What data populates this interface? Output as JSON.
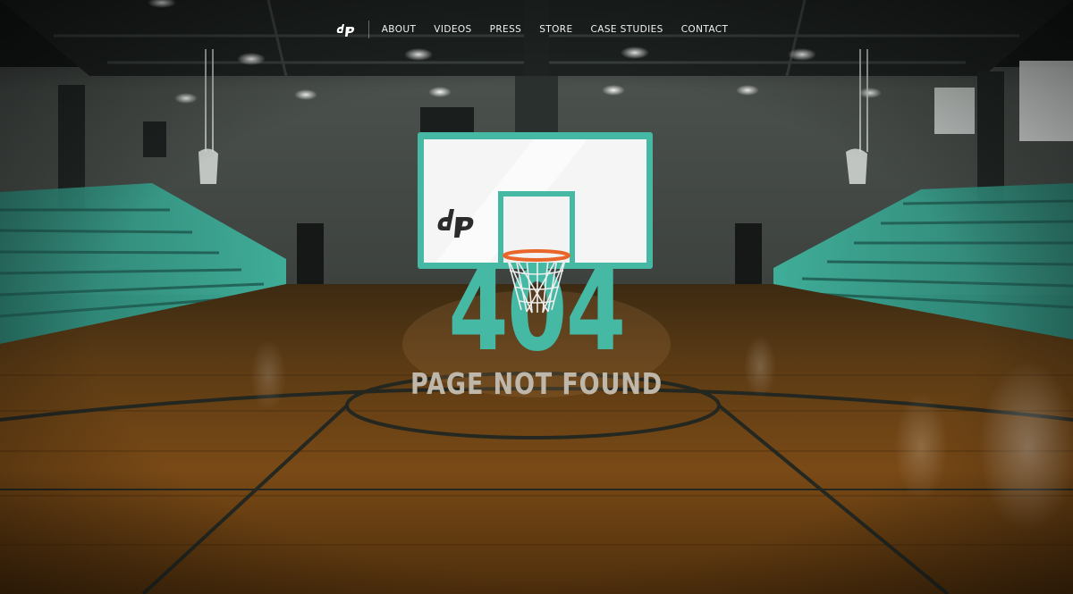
{
  "nav": {
    "logo_icon": "dp-logo-icon",
    "items": [
      "ABOUT",
      "VIDEOS",
      "PRESS",
      "STORE",
      "CASE STUDIES",
      "CONTACT"
    ]
  },
  "error": {
    "code": "404",
    "message": "PAGE NOT FOUND"
  },
  "colors": {
    "accent": "#45b9a4",
    "message_text": "#bfb8aa",
    "nav_text": "#f2f2f2",
    "rim": "#e8662a",
    "court_wood": "#6b4010"
  }
}
